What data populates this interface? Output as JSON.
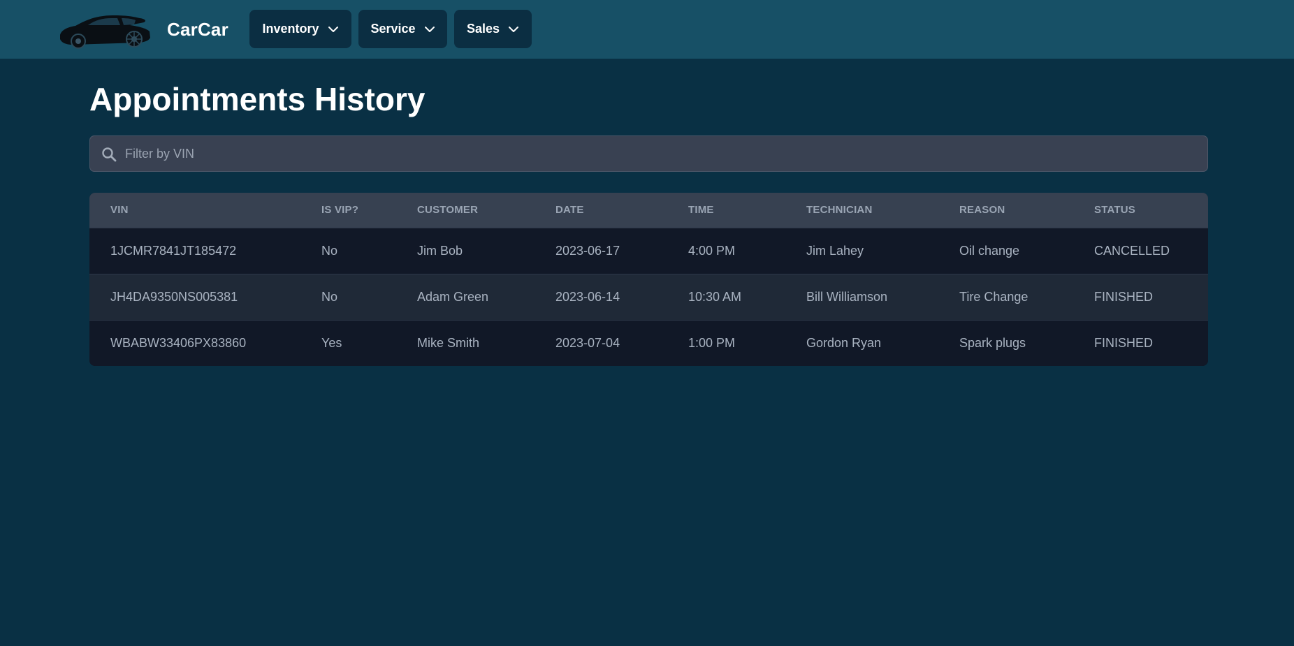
{
  "nav": {
    "brand": "CarCar",
    "items": [
      {
        "label": "Inventory"
      },
      {
        "label": "Service"
      },
      {
        "label": "Sales"
      }
    ]
  },
  "page": {
    "title": "Appointments History"
  },
  "search": {
    "placeholder": "Filter by VIN",
    "value": ""
  },
  "table": {
    "columns": [
      "VIN",
      "Is VIP?",
      "Customer",
      "Date",
      "Time",
      "Technician",
      "Reason",
      "Status"
    ],
    "rows": [
      [
        "1JCMR7841JT185472",
        "No",
        "Jim Bob",
        "2023-06-17",
        "4:00 PM",
        "Jim Lahey",
        "Oil change",
        "CANCELLED"
      ],
      [
        "JH4DA9350NS005381",
        "No",
        "Adam Green",
        "2023-06-14",
        "10:30 AM",
        "Bill Williamson",
        "Tire Change",
        "FINISHED"
      ],
      [
        "WBABW33406PX83860",
        "Yes",
        "Mike Smith",
        "2023-07-04",
        "1:00 PM",
        "Gordon Ryan",
        "Spark plugs",
        "FINISHED"
      ]
    ]
  },
  "colors": {
    "background": "#093044",
    "navbar": "#175066",
    "nav_button": "#0b2e42",
    "table_header": "#374151",
    "row_odd": "#111827",
    "row_even": "#1f2937"
  },
  "icons": {
    "logo": "car-silhouette-icon",
    "dropdown": "chevron-down-icon",
    "search": "magnifier-search-icon"
  }
}
